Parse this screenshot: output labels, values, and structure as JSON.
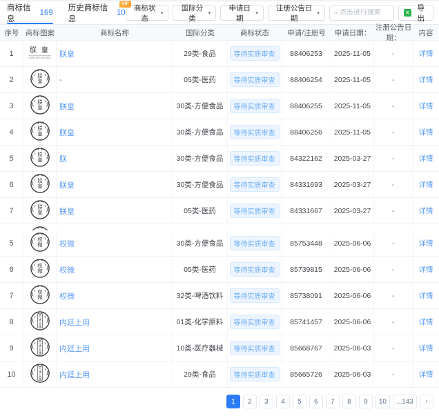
{
  "tabs": {
    "items": [
      {
        "label": "商标信息",
        "count": "169",
        "active": true
      },
      {
        "label": "历史商标信息",
        "count": "10",
        "active": false,
        "badge": "VIP"
      }
    ]
  },
  "toolbar": {
    "filters": [
      "商标状态",
      "国际分类",
      "申请日期",
      "注册公告日期"
    ],
    "search_placeholder": "点击进行搜索",
    "export_label": "导出",
    "export_icon_color": "#2fb350"
  },
  "table": {
    "headers": [
      "序号",
      "商标图案",
      "商标名称",
      "国际分类",
      "商标状态",
      "申请/注册号",
      "申请日期：",
      "注册公告日期：",
      "内容"
    ],
    "status_label": "等待实质审查",
    "detail_label": "详情",
    "empty_value": "-",
    "sections": [
      {
        "rows": [
          {
            "index": "1",
            "logo": {
              "kind": "text-mark",
              "text": "朕 皇",
              "sub": "ZHENHUANG"
            },
            "name": "朕皇",
            "intl_class": "29类-食品",
            "status": "等待实质审查",
            "reg_no": "88406253",
            "apply_date": "2025-11-05",
            "publish_date": "-"
          },
          {
            "index": "2",
            "logo": {
              "kind": "seal",
              "chars": "朕皇"
            },
            "name": "-",
            "intl_class": "05类-医药",
            "status": "等待实质审查",
            "reg_no": "88406254",
            "apply_date": "2025-11-05",
            "publish_date": "-"
          },
          {
            "index": "3",
            "logo": {
              "kind": "seal",
              "chars": "朕皇"
            },
            "name": "朕皇",
            "intl_class": "30类-方便食品",
            "status": "等待实质审查",
            "reg_no": "88406255",
            "apply_date": "2025-11-05",
            "publish_date": "-"
          },
          {
            "index": "4",
            "logo": {
              "kind": "seal",
              "chars": "朕皇"
            },
            "name": "朕皇",
            "intl_class": "30类-方便食品",
            "status": "等待实质审查",
            "reg_no": "88406256",
            "apply_date": "2025-11-05",
            "publish_date": "-"
          },
          {
            "index": "5",
            "logo": {
              "kind": "seal",
              "chars": "朕皇"
            },
            "name": "朕",
            "intl_class": "30类-方便食品",
            "status": "等待实质审查",
            "reg_no": "84322162",
            "apply_date": "2025-03-27",
            "publish_date": "-"
          },
          {
            "index": "6",
            "logo": {
              "kind": "seal",
              "chars": "朕皇"
            },
            "name": "朕皇",
            "intl_class": "30类-方便食品",
            "status": "等待实质审查",
            "reg_no": "84331693",
            "apply_date": "2025-03-27",
            "publish_date": "-"
          },
          {
            "index": "7",
            "logo": {
              "kind": "seal",
              "chars": "朕皇"
            },
            "name": "朕皇",
            "intl_class": "05类-医药",
            "status": "等待实质审查",
            "reg_no": "84331667",
            "apply_date": "2025-03-27",
            "publish_date": "-"
          }
        ]
      },
      {
        "rows": [
          {
            "index": "5",
            "logo": {
              "kind": "seal",
              "chars": "权微"
            },
            "name": "权微",
            "intl_class": "30类-方便食品",
            "status": "等待实质审查",
            "reg_no": "85753448",
            "apply_date": "2025-06-06",
            "publish_date": "-"
          },
          {
            "index": "6",
            "logo": {
              "kind": "seal",
              "chars": "权微"
            },
            "name": "权微",
            "intl_class": "05类-医药",
            "status": "等待实质审查",
            "reg_no": "85739815",
            "apply_date": "2025-06-06",
            "publish_date": "-"
          },
          {
            "index": "7",
            "logo": {
              "kind": "seal",
              "chars": "权微"
            },
            "name": "权微",
            "intl_class": "32类-啤酒饮料",
            "status": "等待实质审查",
            "reg_no": "85738091",
            "apply_date": "2025-06-06",
            "publish_date": "-"
          },
          {
            "index": "8",
            "logo": {
              "kind": "seal",
              "chars": "内廷上用"
            },
            "name": "内廷上用",
            "intl_class": "01类-化学原料",
            "status": "等待实质审查",
            "reg_no": "85741457",
            "apply_date": "2025-06-06",
            "publish_date": "-"
          },
          {
            "index": "9",
            "logo": {
              "kind": "seal",
              "chars": "内廷上用"
            },
            "name": "内廷上用",
            "intl_class": "10类-医疗器械",
            "status": "等待实质审查",
            "reg_no": "85668767",
            "apply_date": "2025-06-03",
            "publish_date": "-"
          },
          {
            "index": "10",
            "logo": {
              "kind": "seal",
              "chars": "内廷上用"
            },
            "name": "内廷上用",
            "intl_class": "29类-食品",
            "status": "等待实质审查",
            "reg_no": "85665726",
            "apply_date": "2025-06-03",
            "publish_date": "-"
          }
        ]
      }
    ]
  },
  "pagination": {
    "pages": [
      "1",
      "2",
      "3",
      "4",
      "5",
      "6",
      "7",
      "8",
      "9",
      "10",
      "...143"
    ],
    "active": "1",
    "next_label": "›"
  },
  "colors": {
    "accent_blue": "#2b7cf7",
    "link_blue": "#5b9bf8",
    "status_bg": "#ecf5ff",
    "status_text": "#70aef9",
    "vip_orange": "#ff9c2e",
    "export_green": "#2fb350"
  }
}
